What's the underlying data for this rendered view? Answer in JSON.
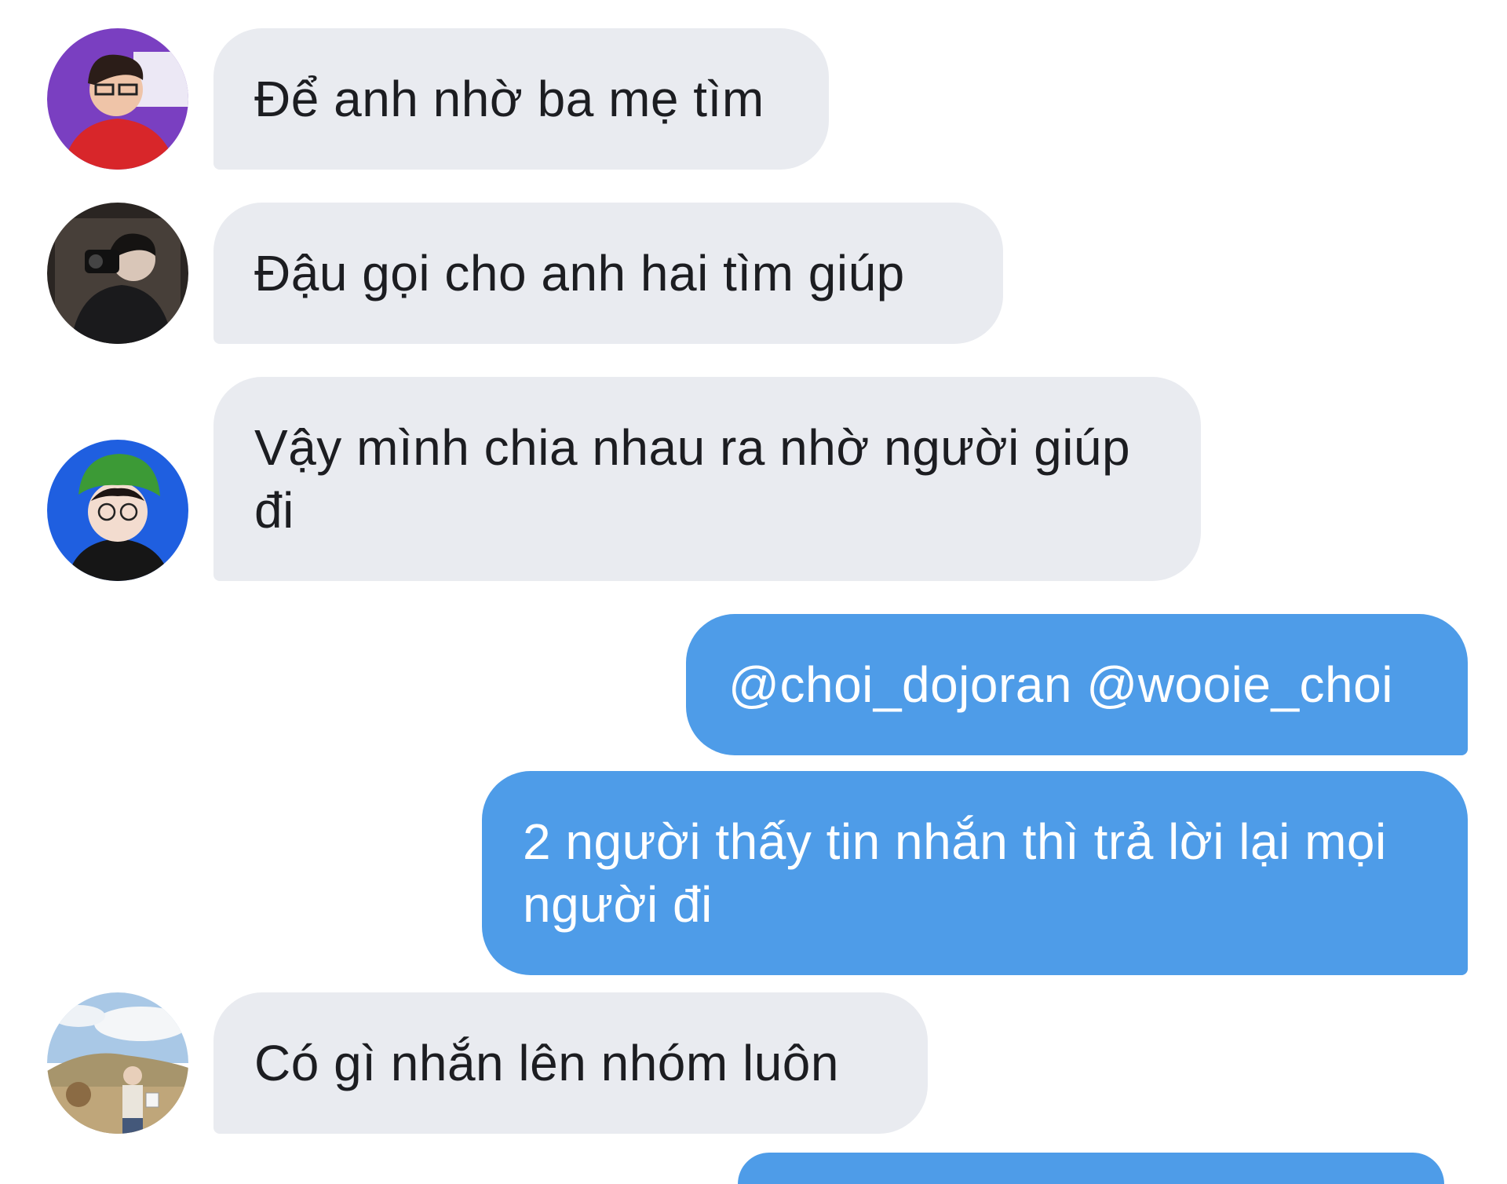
{
  "messages": [
    {
      "sender": "contact",
      "avatar": "avatar-1",
      "text": "Để anh nhờ ba mẹ tìm"
    },
    {
      "sender": "contact",
      "avatar": "avatar-2",
      "text": "Đậu gọi cho anh hai tìm giúp"
    },
    {
      "sender": "contact",
      "avatar": "avatar-3",
      "text": "Vậy mình chia nhau ra nhờ người giúp đi"
    },
    {
      "sender": "self",
      "text": "@choi_dojoran @wooie_choi"
    },
    {
      "sender": "self",
      "text": "2 người thấy tin nhắn thì trả lời lại mọi người đi"
    },
    {
      "sender": "contact",
      "avatar": "avatar-4",
      "text": "Có gì nhắn lên nhóm luôn"
    }
  ],
  "colors": {
    "incoming_bubble": "#e9ebf0",
    "outgoing_bubble": "#4e9ce8",
    "incoming_text": "#1c1d21",
    "outgoing_text": "#ffffff"
  }
}
